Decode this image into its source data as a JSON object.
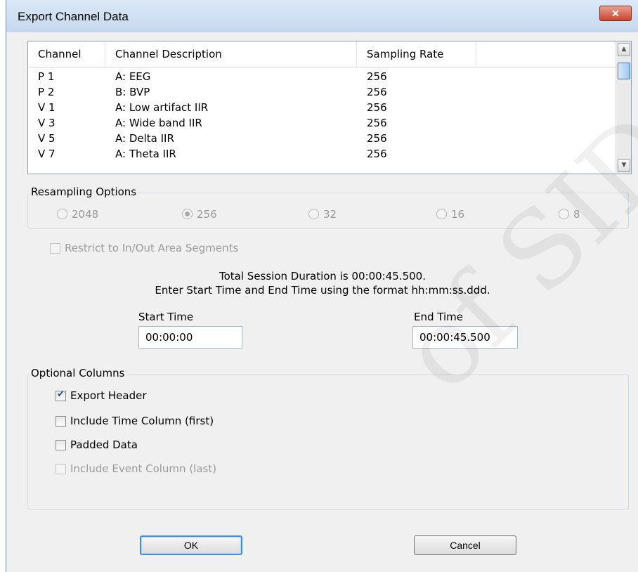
{
  "window": {
    "title": "Export Channel Data",
    "close_label": "✕"
  },
  "channel_list": {
    "headers": [
      "Channel",
      "Channel Description",
      "Sampling Rate",
      ""
    ],
    "rows": [
      {
        "channel": "P 1",
        "description": "A: EEG",
        "rate": "256"
      },
      {
        "channel": "P 2",
        "description": "B: BVP",
        "rate": "256"
      },
      {
        "channel": "V 1",
        "description": "A: Low artifact IIR",
        "rate": "256"
      },
      {
        "channel": "V 3",
        "description": "A: Wide band IIR",
        "rate": "256"
      },
      {
        "channel": "V 5",
        "description": "A: Delta IIR",
        "rate": "256"
      },
      {
        "channel": "V 7",
        "description": "A: Theta IIR",
        "rate": "256"
      }
    ]
  },
  "resampling": {
    "label": "Resampling Options",
    "options": [
      {
        "label": "2048",
        "selected": false
      },
      {
        "label": "256",
        "selected": true
      },
      {
        "label": "32",
        "selected": false
      },
      {
        "label": "16",
        "selected": false
      },
      {
        "label": "8",
        "selected": false
      }
    ],
    "enabled": false
  },
  "restrict": {
    "label": "Restrict to In/Out Area Segments",
    "checked": false,
    "enabled": false
  },
  "session": {
    "duration_text": "Total Session Duration is 00:00:45.500.",
    "instructions": "Enter Start Time and End Time using the format hh:mm:ss.ddd."
  },
  "start_time": {
    "label": "Start Time",
    "value": "00:00:00"
  },
  "end_time": {
    "label": "End Time",
    "value": "00:00:45.500"
  },
  "optional_columns": {
    "label": "Optional Columns",
    "items": [
      {
        "label": "Export Header",
        "checked": true,
        "enabled": true
      },
      {
        "label": "Include Time Column (first)",
        "checked": false,
        "enabled": true
      },
      {
        "label": "Padded Data",
        "checked": false,
        "enabled": true
      },
      {
        "label": "Include Event Column (last)",
        "checked": false,
        "enabled": false
      }
    ]
  },
  "buttons": {
    "ok": "OK",
    "cancel": "Cancel"
  },
  "watermark": {
    "text": "of SID"
  },
  "colors": {
    "title_bar": "#c5d8ee",
    "close_button": "#c8452f",
    "default_button_border": "#3c8ed6",
    "dialog_bg": "#f0f0f0"
  }
}
